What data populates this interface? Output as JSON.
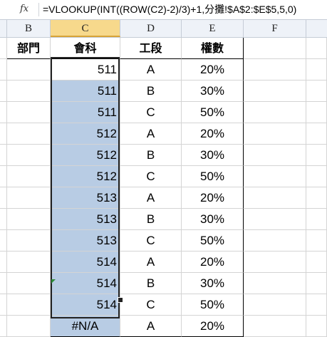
{
  "formula_bar": {
    "fx_icon": "fx-icon",
    "formula": "=VLOOKUP(INT((ROW(C2)-2)/3)+1,分攤!$A$2:$E$5,5,0)"
  },
  "columns": [
    "B",
    "C",
    "D",
    "E",
    "F"
  ],
  "active_column": "C",
  "headers": {
    "b": "部門",
    "c": "會科",
    "d": "工段",
    "e": "權數"
  },
  "rows": [
    {
      "c": "511",
      "d": "A",
      "e": "20%"
    },
    {
      "c": "511",
      "d": "B",
      "e": "30%"
    },
    {
      "c": "511",
      "d": "C",
      "e": "50%"
    },
    {
      "c": "512",
      "d": "A",
      "e": "20%"
    },
    {
      "c": "512",
      "d": "B",
      "e": "30%"
    },
    {
      "c": "512",
      "d": "C",
      "e": "50%"
    },
    {
      "c": "513",
      "d": "A",
      "e": "20%"
    },
    {
      "c": "513",
      "d": "B",
      "e": "30%"
    },
    {
      "c": "513",
      "d": "C",
      "e": "50%"
    },
    {
      "c": "514",
      "d": "A",
      "e": "20%"
    },
    {
      "c": "514",
      "d": "B",
      "e": "30%"
    },
    {
      "c": "514",
      "d": "C",
      "e": "50%"
    },
    {
      "c": "#N/A",
      "d": "A",
      "e": "20%"
    }
  ],
  "colors": {
    "selection": "#b8cce4",
    "active_header": "#f7d98c",
    "error_indicator": "#2e8b3a"
  }
}
